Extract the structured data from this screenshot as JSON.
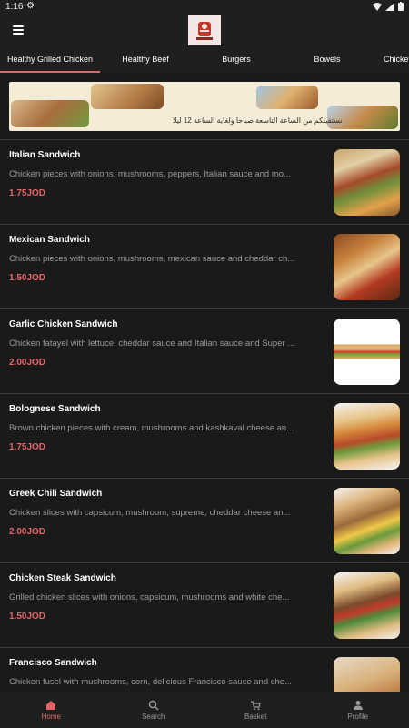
{
  "status": {
    "time": "1:16"
  },
  "tabs": [
    "Healthy Grilled Chicken",
    "Healthy Beef",
    "Burgers",
    "Bowels",
    "Chicke"
  ],
  "banner": {
    "text": "نستقبلكم من الساعة التاسعة صباحا ولغاية الساعة 12 ليلا"
  },
  "items": [
    {
      "name": "Italian Sandwich",
      "desc": "Chicken pieces with onions, mushrooms, peppers, Italian sauce and mo...",
      "price": "1.75JOD"
    },
    {
      "name": "Mexican Sandwich",
      "desc": "Chicken pieces with onions, mushrooms, mexican sauce and cheddar ch...",
      "price": "1.50JOD"
    },
    {
      "name": "Garlic Chicken Sandwich",
      "desc": "Chicken fatayel with lettuce, cheddar sauce and Italian sauce and Super ...",
      "price": "2.00JOD"
    },
    {
      "name": "Bolognese Sandwich",
      "desc": "Brown chicken pieces with cream, mushrooms and kashkaval cheese an...",
      "price": "1.75JOD"
    },
    {
      "name": "Greek Chili Sandwich",
      "desc": "Chicken slices with capsicum, mushroom, supreme, cheddar cheese an...",
      "price": "2.00JOD"
    },
    {
      "name": "Chicken Steak Sandwich",
      "desc": "Grilled chicken slices with onions, capsicum, mushrooms and white che...",
      "price": "1.50JOD"
    },
    {
      "name": "Francisco Sandwich",
      "desc": "Chicken fusel with mushrooms, corn, delicious Francisco sauce and che...",
      "price": ""
    }
  ],
  "nav": {
    "home": "Home",
    "search": "Search",
    "basket": "Basket",
    "profile": "Profile"
  },
  "colors": {
    "accent": "#e4646a",
    "background": "#1a1a1a"
  }
}
